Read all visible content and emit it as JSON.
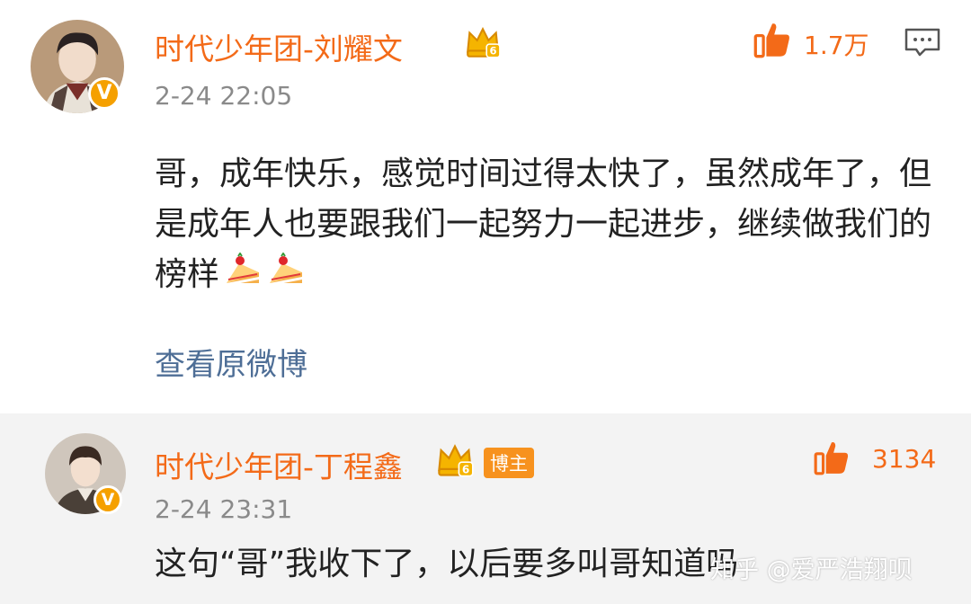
{
  "comments": [
    {
      "author": "时代少年团-刘耀文",
      "verified_icon": "v-badge-icon",
      "vip_icon": "crown-icon",
      "time": "2-24 22:05",
      "likes": "1.7万",
      "text": "哥，成年快乐，感觉时间过得太快了，虽然成年了，但是成年人也要跟我们一起努力一起进步，继续做我们的榜样",
      "emoji_icons": [
        "cake-icon",
        "cake-icon"
      ],
      "view_original": "查看原微博"
    },
    {
      "author": "时代少年团-丁程鑫",
      "verified_icon": "v-badge-icon",
      "vip_icon": "crown-icon",
      "host_badge": "博主",
      "time": "2-24 23:31",
      "likes": "3134",
      "text": "这句“哥”我收下了，以后要多叫哥知道吗"
    }
  ],
  "verified_mark": "V",
  "watermark": "知乎 @爱严浩翔呗",
  "colors": {
    "name": "#f36a18",
    "link": "#4e6e96",
    "time": "#8a8a8a",
    "verified": "#f5a000",
    "reply_bg": "#f3f3f3"
  }
}
